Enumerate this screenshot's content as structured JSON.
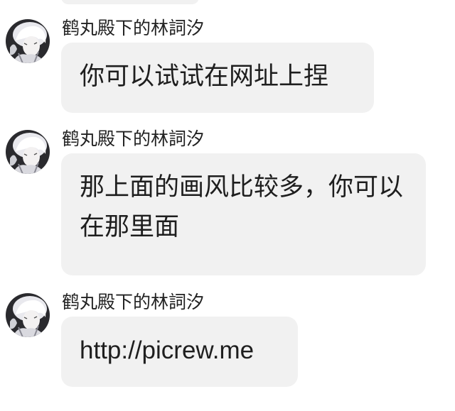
{
  "chat": {
    "messages": [
      {
        "sender": "鹤丸殿下的林詞汐",
        "text": "你可以试试在网址上捏"
      },
      {
        "sender": "鹤丸殿下的林詞汐",
        "text": "那上面的画风比较多，你可以在那里面"
      },
      {
        "sender": "鹤丸殿下的林詞汐",
        "text": "http://picrew.me"
      }
    ]
  },
  "colors": {
    "bubble": "#f1f1f1",
    "text": "#1e1e1e",
    "background": "#ffffff"
  },
  "icons": {
    "avatar": "avatar-anime-white-hair"
  }
}
